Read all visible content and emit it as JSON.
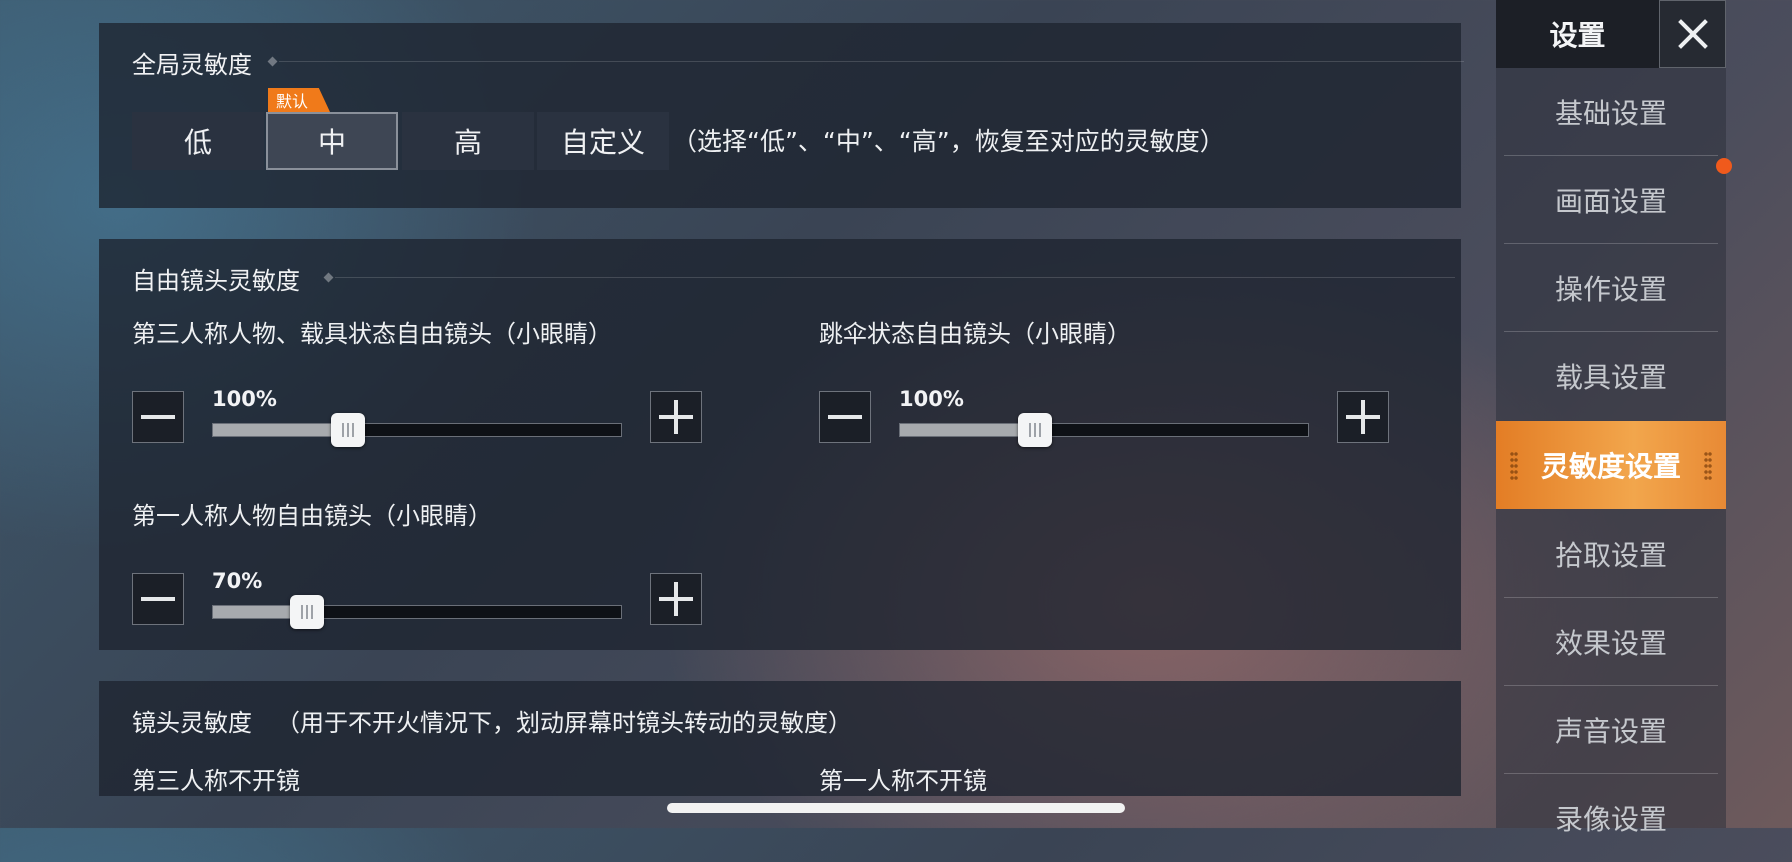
{
  "global_sensitivity": {
    "title": "全局灵敏度",
    "default_tag": "默认",
    "options": [
      "低",
      "中",
      "高",
      "自定义"
    ],
    "selected": "中",
    "hint": "（选择“低”、“中”、“高”，恢复至对应的灵敏度）"
  },
  "free_camera": {
    "title": "自由镜头灵敏度",
    "items": [
      {
        "label": "第三人称人物、载具状态自由镜头（小眼睛）",
        "value": "100%",
        "level": 0.33
      },
      {
        "label": "跳伞状态自由镜头（小眼睛）",
        "value": "100%",
        "level": 0.33
      },
      {
        "label": "第一人称人物自由镜头（小眼睛）",
        "value": "70%",
        "level": 0.23
      }
    ]
  },
  "camera_sensitivity": {
    "title": "镜头灵敏度",
    "note": "（用于不开火情况下，划动屏幕时镜头转动的灵敏度）",
    "col1": "第三人称不开镜",
    "col2": "第一人称不开镜"
  },
  "sidebar": {
    "title": "设置",
    "items": [
      "基础设置",
      "画面设置",
      "操作设置",
      "载具设置",
      "灵敏度设置",
      "拾取设置",
      "效果设置",
      "声音设置",
      "录像设置"
    ],
    "active": "灵敏度设置"
  },
  "colors": {
    "accent": "#f07a1a",
    "notification": "#f05a1c"
  }
}
